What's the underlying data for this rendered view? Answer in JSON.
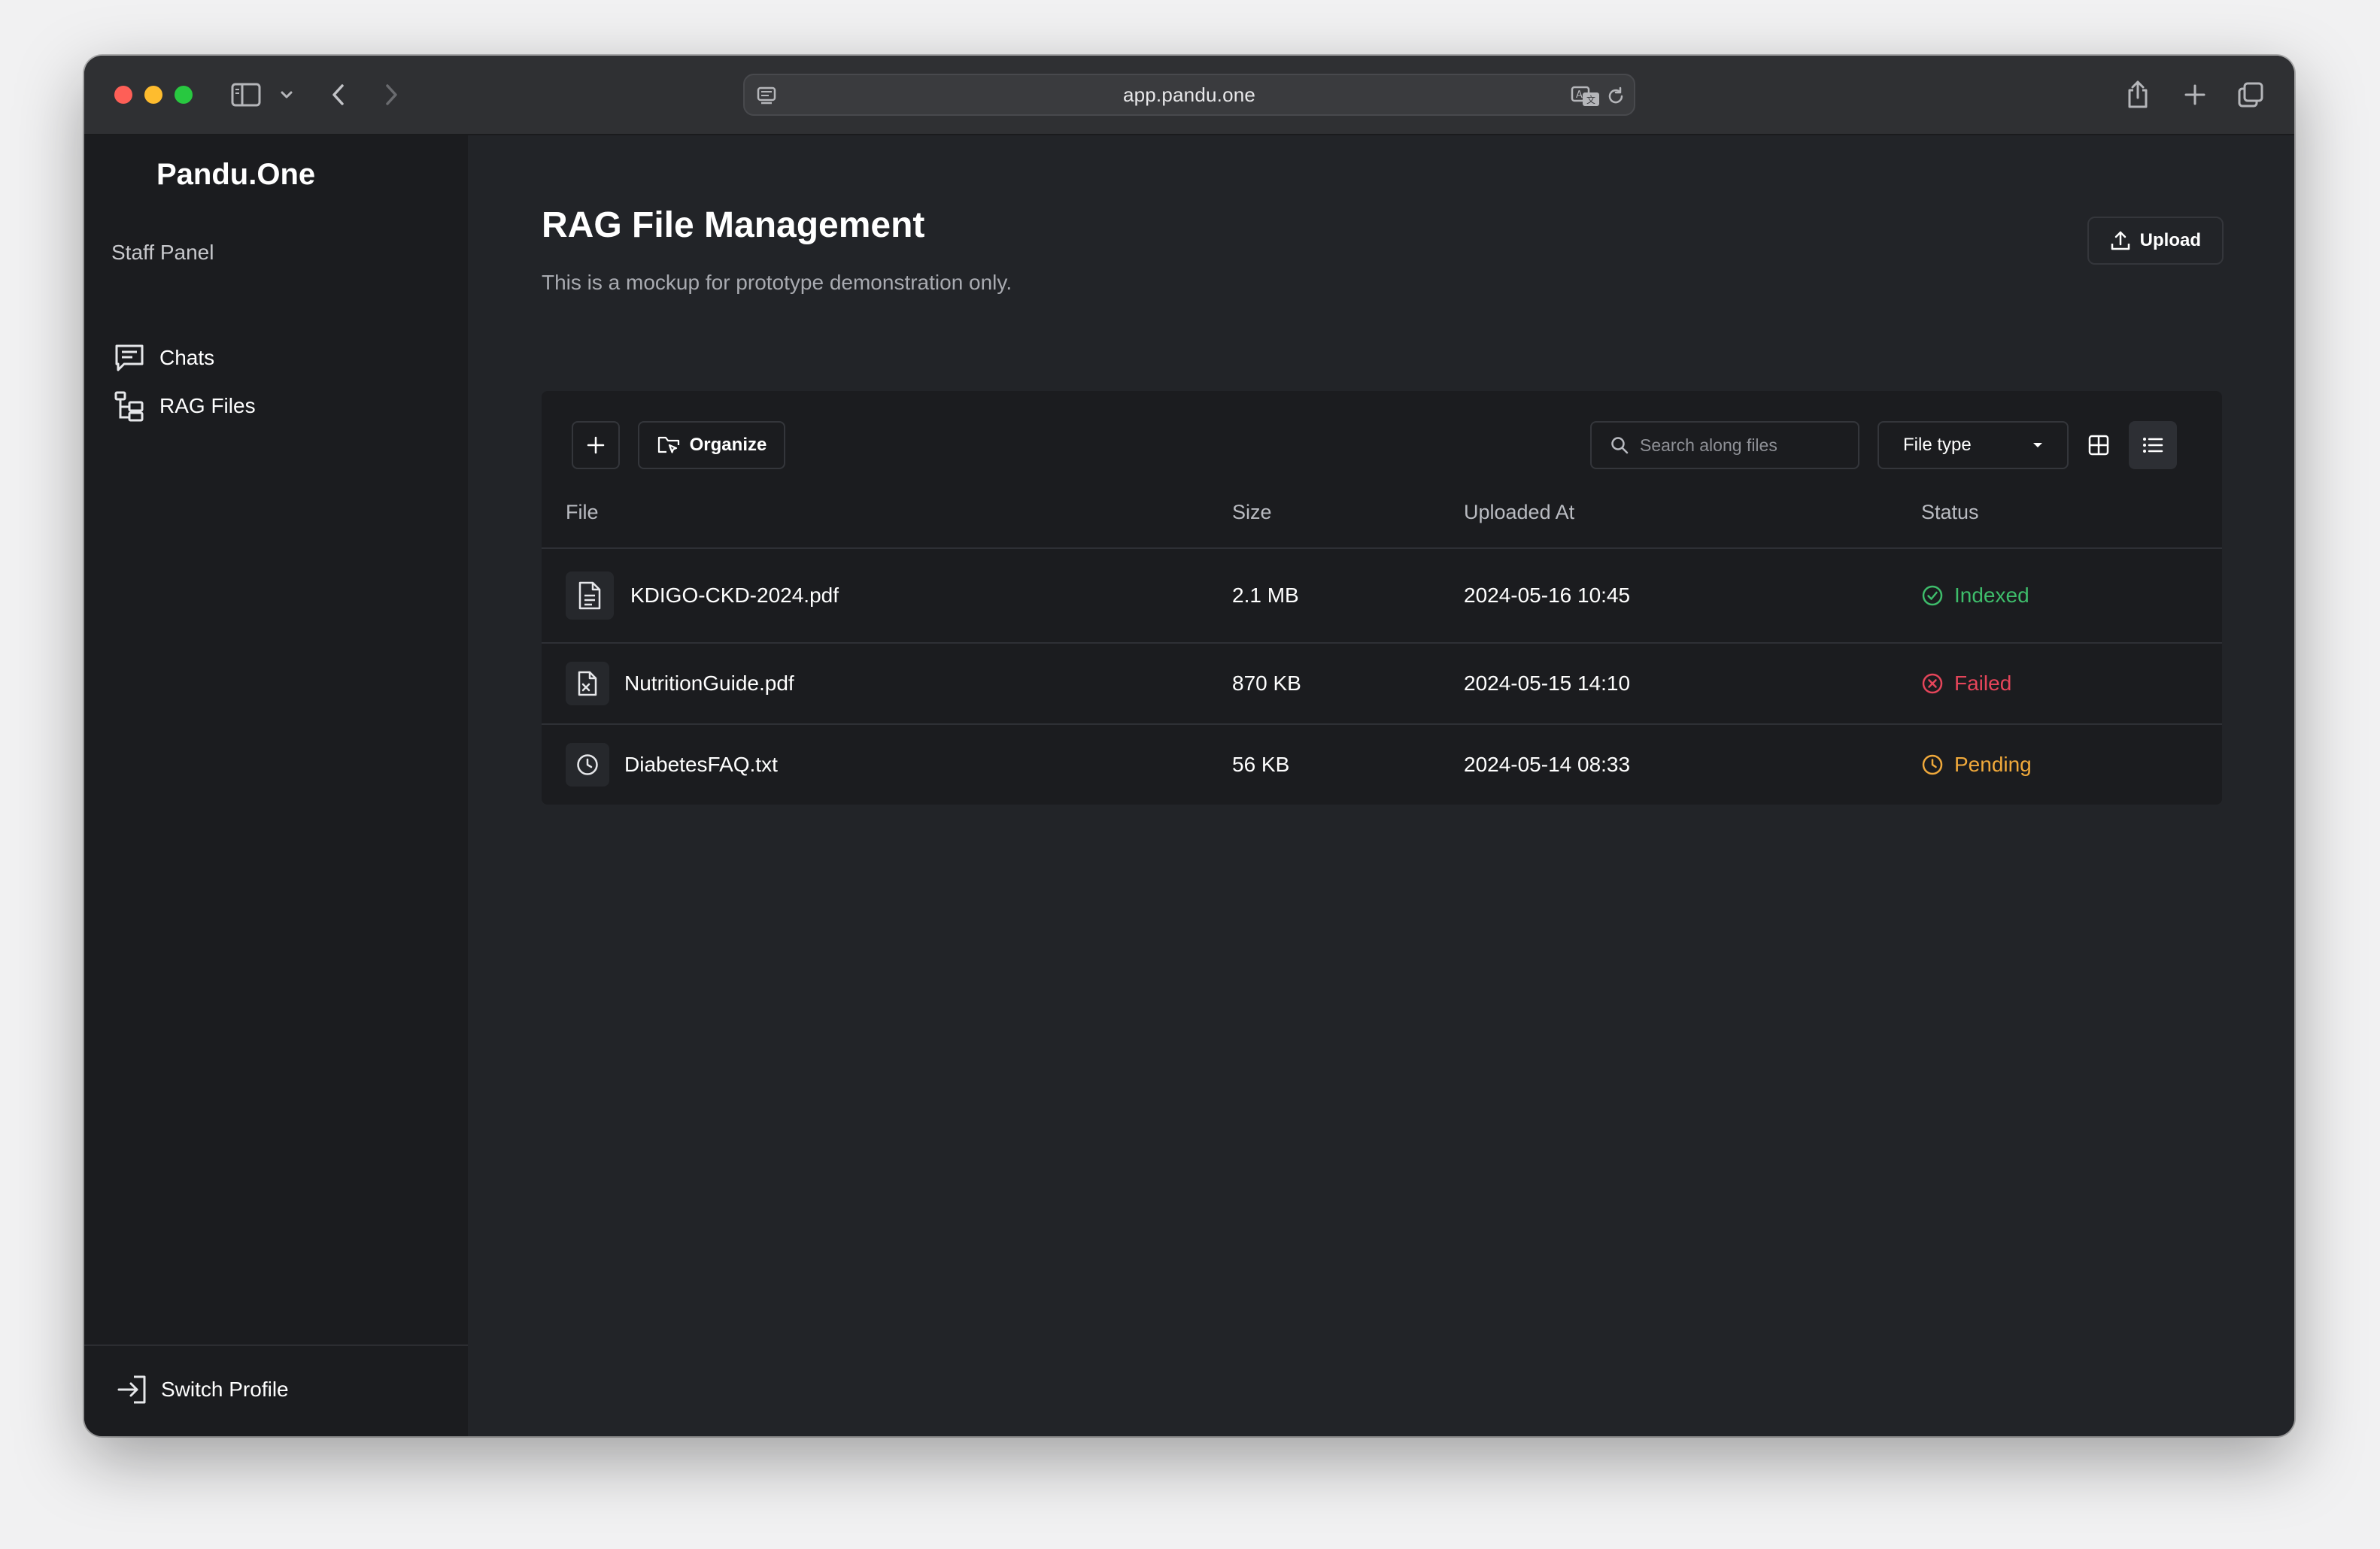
{
  "browser": {
    "url": "app.pandu.one"
  },
  "sidebar": {
    "brand": "Pandu.One",
    "section_label": "Staff Panel",
    "items": [
      {
        "label": "Chats",
        "icon": "chat-icon"
      },
      {
        "label": "RAG Files",
        "icon": "folder-tree-icon"
      }
    ],
    "footer": {
      "label": "Switch Profile",
      "icon": "sign-in-icon"
    }
  },
  "header": {
    "title": "RAG File Management",
    "subtitle": "This is a mockup for prototype demonstration only.",
    "upload_label": "Upload"
  },
  "toolbar": {
    "add_icon": "plus-icon",
    "organize_label": "Organize",
    "search_placeholder": "Search along files",
    "filter_label": "File type",
    "view_modes": [
      "grid",
      "list"
    ],
    "active_view": "list"
  },
  "table": {
    "columns": [
      "File",
      "Size",
      "Uploaded At",
      "Status"
    ],
    "rows": [
      {
        "name": "KDIGO-CKD-2024.pdf",
        "size": "2.1 MB",
        "uploaded_at": "2024-05-16 10:45",
        "status": "Indexed",
        "status_color": "#3ebd6b",
        "icon": "document-icon"
      },
      {
        "name": "NutritionGuide.pdf",
        "size": "870 KB",
        "uploaded_at": "2024-05-15 14:10",
        "status": "Failed",
        "status_color": "#e5455a",
        "icon": "file-error-icon"
      },
      {
        "name": "DiabetesFAQ.txt",
        "size": "56 KB",
        "uploaded_at": "2024-05-14 08:33",
        "status": "Pending",
        "status_color": "#f0a93b",
        "icon": "clock-icon"
      }
    ]
  }
}
